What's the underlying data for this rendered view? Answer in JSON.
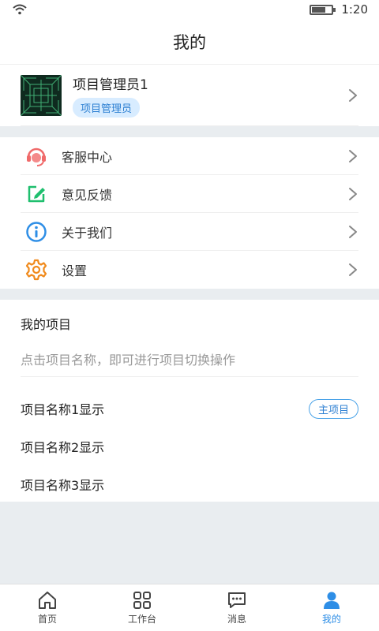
{
  "status_bar": {
    "time": "1:20",
    "battery_level": 0.65
  },
  "header": {
    "title": "我的"
  },
  "profile": {
    "name": "项目管理员1",
    "role": "项目管理员"
  },
  "menu": {
    "items": [
      {
        "label": "客服中心",
        "icon": "headset-icon",
        "color": "#f06a6a"
      },
      {
        "label": "意见反馈",
        "icon": "edit-icon",
        "color": "#1fbf6e"
      },
      {
        "label": "关于我们",
        "icon": "info-icon",
        "color": "#2e8ee6"
      },
      {
        "label": "设置",
        "icon": "gear-icon",
        "color": "#f08a1c"
      }
    ]
  },
  "projects": {
    "title": "我的项目",
    "hint": "点击项目名称，即可进行项目切换操作",
    "items": [
      {
        "name": "项目名称1显示",
        "badge": "主项目"
      },
      {
        "name": "项目名称2显示"
      },
      {
        "name": "项目名称3显示"
      }
    ]
  },
  "tabbar": {
    "tabs": [
      {
        "label": "首页",
        "icon": "home-icon"
      },
      {
        "label": "工作台",
        "icon": "grid-icon"
      },
      {
        "label": "消息",
        "icon": "message-icon"
      },
      {
        "label": "我的",
        "icon": "user-icon",
        "active": true
      }
    ]
  },
  "colors": {
    "accent": "#2e8ee6",
    "badge_bg": "#d8ecff"
  }
}
